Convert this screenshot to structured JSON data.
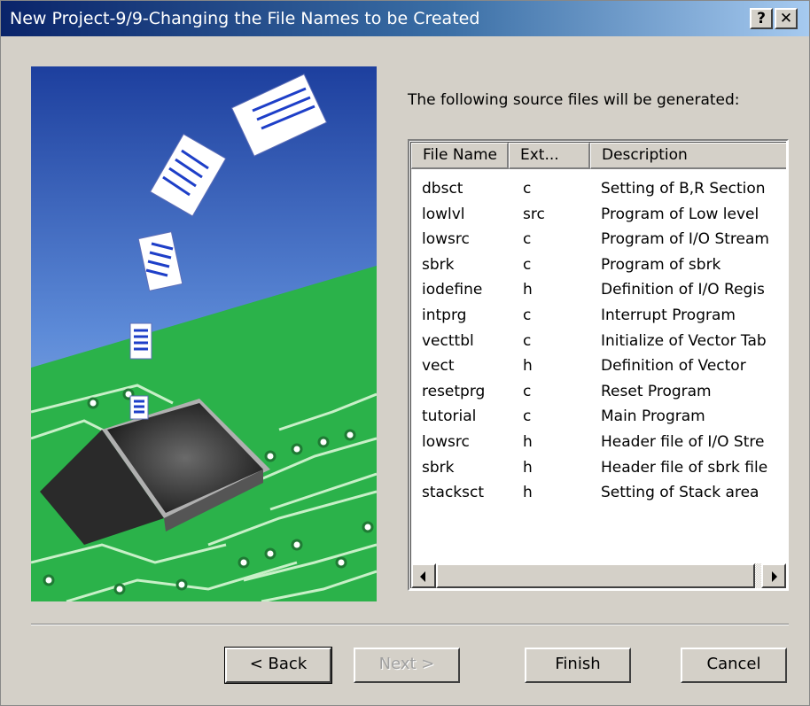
{
  "window": {
    "title": "New Project-9/9-Changing the File Names to be Created",
    "help_label": "?",
    "close_label": "✕"
  },
  "intro_text": "The following source files will be generated:",
  "table": {
    "columns": [
      "File Name",
      "Ext...",
      "Description"
    ],
    "rows": [
      {
        "name": "dbsct",
        "ext": "c",
        "desc": "Setting of B,R Section"
      },
      {
        "name": "lowlvl",
        "ext": "src",
        "desc": "Program of Low level"
      },
      {
        "name": "lowsrc",
        "ext": "c",
        "desc": "Program of I/O Stream"
      },
      {
        "name": "sbrk",
        "ext": "c",
        "desc": "Program of sbrk"
      },
      {
        "name": "iodefine",
        "ext": "h",
        "desc": "Definition of I/O Regis"
      },
      {
        "name": "intprg",
        "ext": "c",
        "desc": "Interrupt Program"
      },
      {
        "name": "vecttbl",
        "ext": "c",
        "desc": "Initialize of Vector Tab"
      },
      {
        "name": "vect",
        "ext": "h",
        "desc": "Definition of Vector"
      },
      {
        "name": "resetprg",
        "ext": "c",
        "desc": "Reset Program"
      },
      {
        "name": "tutorial",
        "ext": "c",
        "desc": "Main Program"
      },
      {
        "name": "lowsrc",
        "ext": "h",
        "desc": "Header file of I/O Stre"
      },
      {
        "name": "sbrk",
        "ext": "h",
        "desc": "Header file of sbrk file"
      },
      {
        "name": "stacksct",
        "ext": "h",
        "desc": "Setting of Stack area"
      }
    ]
  },
  "buttons": {
    "back": "< Back",
    "next": "Next >",
    "finish": "Finish",
    "cancel": "Cancel"
  },
  "icons": {
    "help": "question-mark-icon",
    "close": "close-icon",
    "scroll_left": "arrow-left-icon",
    "scroll_right": "arrow-right-icon"
  },
  "colors": {
    "titlebar_start": "#0a246a",
    "titlebar_end": "#a6caf0",
    "dialog_bg": "#d4d0c8",
    "circuit_green": "#2bb24a"
  }
}
